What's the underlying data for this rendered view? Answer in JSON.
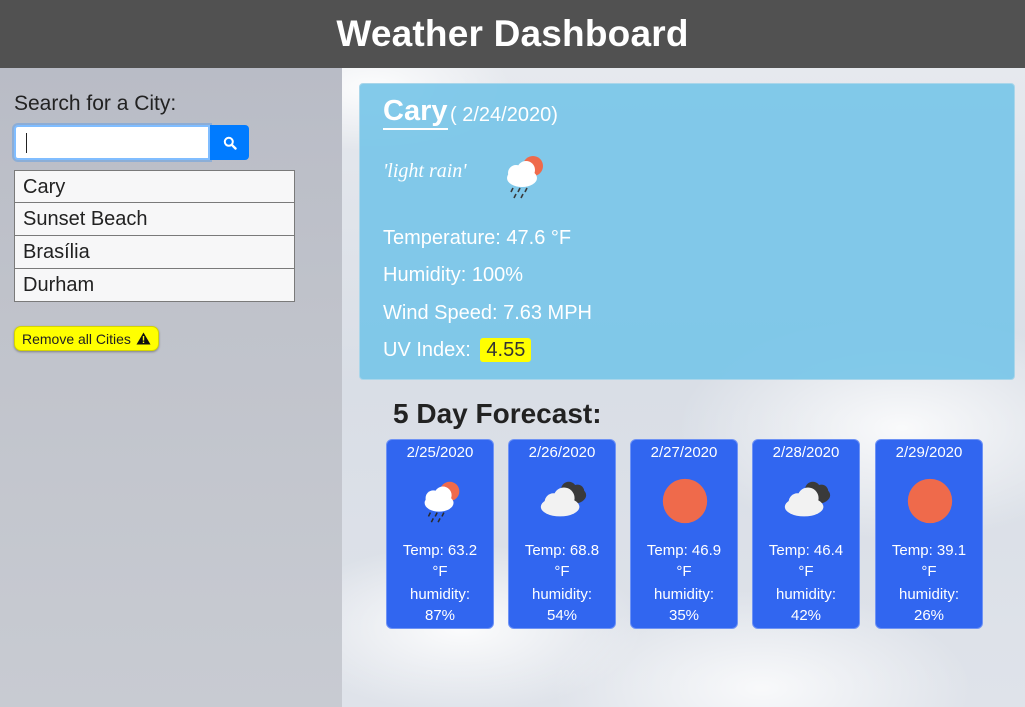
{
  "header": {
    "title": "Weather Dashboard"
  },
  "search": {
    "label": "Search for a City:",
    "value": "",
    "button_icon": "search-icon"
  },
  "cities": [
    {
      "name": "Cary"
    },
    {
      "name": "Sunset Beach"
    },
    {
      "name": "Brasília"
    },
    {
      "name": "Durham"
    }
  ],
  "remove_button": {
    "label": "Remove all Cities",
    "icon": "warning-icon"
  },
  "current": {
    "city": "Cary",
    "date": "( 2/24/2020)",
    "description": "'light rain'",
    "icon": "rain-sun-icon",
    "temperature": "Temperature: 47.6 °F",
    "humidity": "Humidity: 100%",
    "wind": "Wind Speed: 7.63 MPH",
    "uv_label": "UV Index:",
    "uv_value": "4.55"
  },
  "forecast": {
    "title": "5 Day Forecast:",
    "days": [
      {
        "date": "2/25/2020",
        "icon": "rain-sun-icon",
        "temp": "Temp: 63.2",
        "unit": "°F",
        "hum_label": "humidity:",
        "hum": "87%"
      },
      {
        "date": "2/26/2020",
        "icon": "cloudy-icon",
        "temp": "Temp: 68.8",
        "unit": "°F",
        "hum_label": "humidity:",
        "hum": "54%"
      },
      {
        "date": "2/27/2020",
        "icon": "sun-icon",
        "temp": "Temp: 46.9",
        "unit": "°F",
        "hum_label": "humidity:",
        "hum": "35%"
      },
      {
        "date": "2/28/2020",
        "icon": "cloudy-icon",
        "temp": "Temp: 46.4",
        "unit": "°F",
        "hum_label": "humidity:",
        "hum": "42%"
      },
      {
        "date": "2/29/2020",
        "icon": "sun-icon",
        "temp": "Temp: 39.1",
        "unit": "°F",
        "hum_label": "humidity:",
        "hum": "26%"
      }
    ]
  },
  "colors": {
    "header_bg": "#515151",
    "current_card": "#78c6e8",
    "forecast_card": "#3166f0",
    "uv_highlight": "#ffff00",
    "search_button": "#007bff",
    "sun": "#ef6a4b"
  }
}
